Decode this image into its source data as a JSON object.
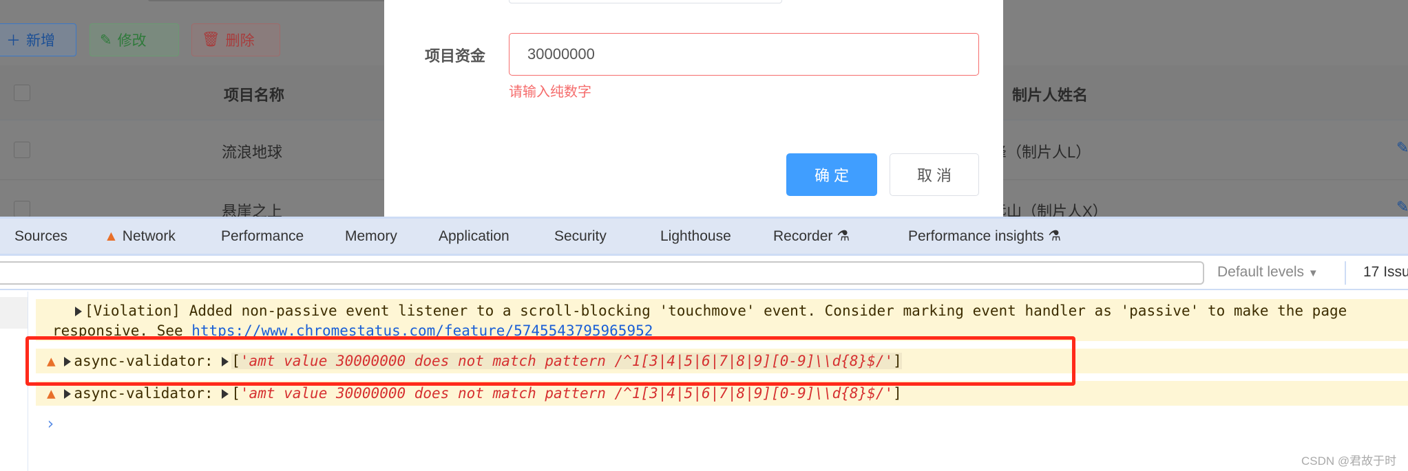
{
  "toolbar": {
    "add": "新增",
    "edit": "修改",
    "delete": "删除"
  },
  "table": {
    "headers": [
      "项目名称",
      "制片人姓名"
    ],
    "rows": [
      {
        "name": "流浪地球",
        "producer": "峰（制片人L）"
      },
      {
        "name": "悬崖之上",
        "producer": "远山（制片人X）"
      }
    ]
  },
  "modal": {
    "field_label": "项目资金",
    "field_value": "30000000",
    "error": "请输入纯数字",
    "confirm": "确 定",
    "cancel": "取 消"
  },
  "devtools": {
    "tabs": [
      "Sources",
      "Network",
      "Performance",
      "Memory",
      "Application",
      "Security",
      "Lighthouse",
      "Recorder",
      "Performance insights"
    ],
    "levels": "Default levels",
    "issues": "17 Issu",
    "messages": {
      "violation_1": "[Violation] Added non-passive event listener to a scroll-blocking 'touchmove' event. Consider marking event handler as 'passive' to make the page",
      "violation_2": "responsive. See ",
      "violation_link": "https://www.chromestatus.com/feature/5745543795965952",
      "source": "async-validator: ",
      "bracket_open": "[",
      "error": "'amt value 30000000 does not match pattern /^1[3|4|5|6|7|8|9][0-9]\\\\d{8}$/'",
      "bracket_close": "]"
    },
    "prompt": "›"
  },
  "watermark": "CSDN @君故于时",
  "colors": {
    "primary": "#409eff",
    "danger": "#f56c6c",
    "warning": "#e8702a",
    "highlight": "#ff2a1a"
  }
}
